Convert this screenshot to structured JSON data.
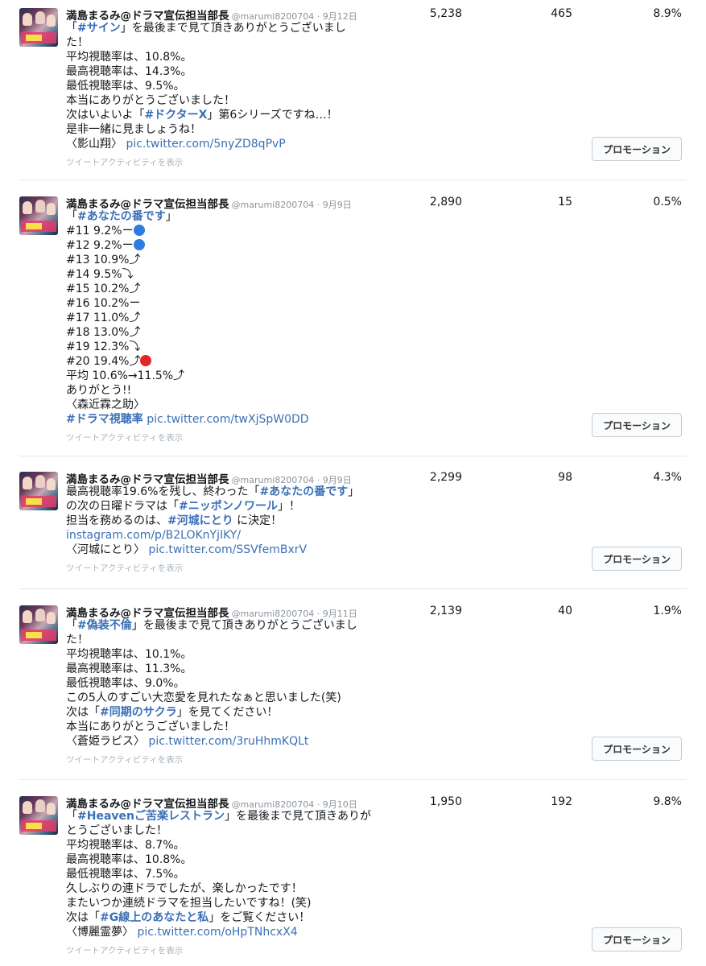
{
  "activity_label": "ツイートアクティビティを表示",
  "promo_label": "プロモーション",
  "author": "満島まるみ@ドラマ宣伝担当部長",
  "handle": "@marumi8200704",
  "tweets": [
    {
      "date": "· 9月12日",
      "impressions": "5,238",
      "engagements": "465",
      "rate": "8.9%",
      "lines": [
        [
          "「",
          {
            "tag": "#サイン"
          },
          "」を最後まで見て頂きありがとうございまし"
        ],
        [
          "た！"
        ],
        [
          "平均視聴率は、10.8%。"
        ],
        [
          "最高視聴率は、14.3%。"
        ],
        [
          "最低視聴率は、9.5%。"
        ],
        [
          "本当にありがとうございました！"
        ],
        [
          "次はいよいよ「",
          {
            "tag": "#ドクターX"
          },
          "」第6シリーズですね…！"
        ],
        [
          "是非一緒に見ましょうね！"
        ],
        [
          "〈影山翔〉 ",
          {
            "link": "pic.twitter.com/5nyZD8qPvP"
          }
        ]
      ]
    },
    {
      "date": "· 9月9日",
      "impressions": "2,890",
      "engagements": "15",
      "rate": "0.5%",
      "lines": [
        [
          "「",
          {
            "tag": "#あなたの番です"
          },
          "」"
        ],
        [
          "#11 9.2%ー",
          {
            "emoji": "blue"
          }
        ],
        [
          "#12 9.2%ー",
          {
            "emoji": "blue"
          }
        ],
        [
          "#13 10.9%⤴"
        ],
        [
          "#14 9.5%⤵"
        ],
        [
          "#15 10.2%⤴"
        ],
        [
          "#16 10.2%ー"
        ],
        [
          "#17 11.0%⤴"
        ],
        [
          "#18 13.0%⤴"
        ],
        [
          "#19 12.3%⤵"
        ],
        [
          "#20 19.4%⤴",
          {
            "emoji": "red"
          }
        ],
        [
          "平均 10.6%→11.5%⤴"
        ],
        [
          "ありがとう!!"
        ],
        [
          "〈森近霖之助〉"
        ],
        [
          {
            "tag": "#ドラマ視聴率"
          },
          " ",
          {
            "link": "pic.twitter.com/twXjSpW0DD"
          }
        ]
      ]
    },
    {
      "date": "· 9月9日",
      "impressions": "2,299",
      "engagements": "98",
      "rate": "4.3%",
      "lines": [
        [
          "最高視聴率19.6%を残し、終わった「",
          {
            "tag": "#あなたの番です"
          },
          "」"
        ],
        [
          "の次の日曜ドラマは「",
          {
            "tag": "#ニッポンノワール"
          },
          "」！"
        ],
        [
          "担当を務めるのは、",
          {
            "tag": "#河城にとり"
          },
          " に決定！"
        ],
        [
          {
            "link": "instagram.com/p/B2LOKnYjIKY/"
          }
        ],
        [
          "〈河城にとり〉 ",
          {
            "link": "pic.twitter.com/SSVfemBxrV"
          }
        ]
      ]
    },
    {
      "date": "· 9月11日",
      "impressions": "2,139",
      "engagements": "40",
      "rate": "1.9%",
      "lines": [
        [
          "「",
          {
            "tag": "#偽装不倫"
          },
          "」を最後まで見て頂きありがとうございまし"
        ],
        [
          "た！"
        ],
        [
          "平均視聴率は、10.1%。"
        ],
        [
          "最高視聴率は、11.3%。"
        ],
        [
          "最低視聴率は、9.0%。"
        ],
        [
          "この5人のすごい大恋愛を見れたなぁと思いました(笑)"
        ],
        [
          "次は「",
          {
            "tag": "#同期のサクラ"
          },
          "」を見てください！"
        ],
        [
          "本当にありがとうございました！"
        ],
        [
          "〈蒼姫ラピス〉 ",
          {
            "link": "pic.twitter.com/3ruHhmKQLt"
          }
        ]
      ]
    },
    {
      "date": "· 9月10日",
      "impressions": "1,950",
      "engagements": "192",
      "rate": "9.8%",
      "lines": [
        [
          "「",
          {
            "tag": "#Heavenご苦楽レストラン"
          },
          "」を最後まで見て頂きありが"
        ],
        [
          "とうございました！"
        ],
        [
          "平均視聴率は、8.7%。"
        ],
        [
          "最高視聴率は、10.8%。"
        ],
        [
          "最低視聴率は、7.5%。"
        ],
        [
          "久しぶりの連ドラでしたが、楽しかったです！"
        ],
        [
          "またいつか連続ドラマを担当したいですね！(笑)"
        ],
        [
          "次は「",
          {
            "tag": "#G線上のあなたと私"
          },
          "」をご覧ください！"
        ],
        [
          "〈博麗霊夢〉 ",
          {
            "link": "pic.twitter.com/oHpTNhcxX4"
          }
        ]
      ]
    }
  ]
}
